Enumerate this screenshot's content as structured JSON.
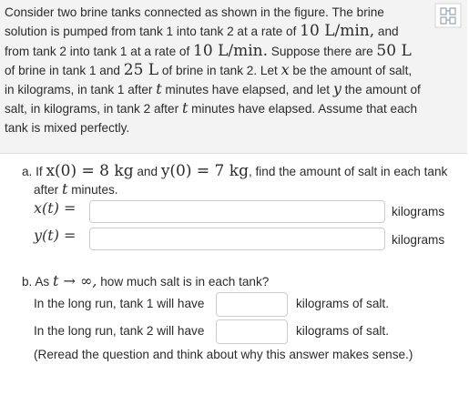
{
  "problem": {
    "t1": "Consider two brine tanks connected as shown in the figure. The brine solution is pumped from tank 1 into tank 2 at a rate of ",
    "rate1": "10 L/min,",
    "t2": " and from tank 2 into tank 1 at a rate of ",
    "rate2": "10 L/min.",
    "t3": " Suppose there are ",
    "vol1": "50 L",
    "t4": " of brine in tank 1 and ",
    "vol2": "25 L",
    "t5": " of brine in tank 2. Let ",
    "var_x": "x",
    "t6": " be the amount of salt, in kilograms, in tank 1 after ",
    "var_t1": "t",
    "t7": " minutes have elapsed, and let ",
    "var_y": "y",
    "t8": " the amount of salt, in kilograms, in tank 2 after ",
    "var_t2": "t",
    "t9": " minutes have elapsed. Assume that each tank is mixed perfectly."
  },
  "part_a": {
    "prefix": "a. If ",
    "cond1": "x(0) = 8 kg",
    "and": " and ",
    "cond2": "y(0) = 7 kg",
    "suffix": ", find the amount of salt in each tank",
    "line2_prefix": "after ",
    "line2_var": "t",
    "line2_suffix": " minutes.",
    "x_label": "x(t) =",
    "y_label": "y(t) =",
    "x_value": "",
    "y_value": "",
    "unit_x": "kilograms",
    "unit_y": "kilograms"
  },
  "part_b": {
    "prefix": "b. As ",
    "limit": "t → ∞,",
    "suffix": " how much salt is in each tank?",
    "row1_label": "In the long run, tank 1 will have",
    "row1_unit": "kilograms of salt.",
    "row1_value": "",
    "row2_label": "In the long run, tank 2 will have",
    "row2_unit": "kilograms of salt.",
    "row2_value": "",
    "note": "(Reread the question and think about why this answer makes sense.)"
  },
  "icons": {
    "corner": "expand-figure-icon"
  }
}
